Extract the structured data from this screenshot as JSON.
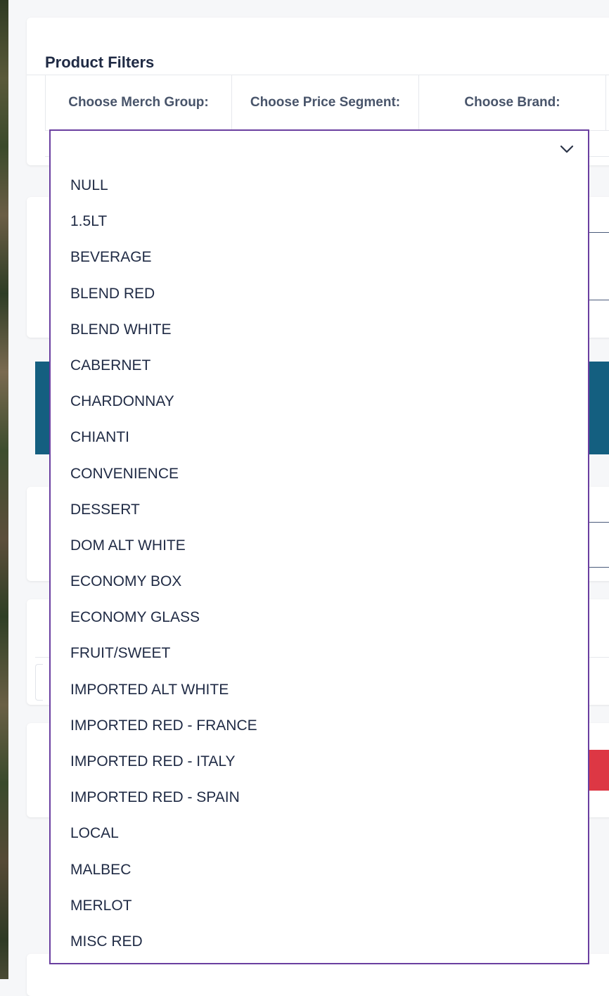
{
  "filters": {
    "title": "Product Filters",
    "merch_group_label": "Choose Merch Group:",
    "price_segment_label": "Choose Price Segment:",
    "brand_label": "Choose Brand:"
  },
  "dropdown": {
    "open_for": "merch_group",
    "icon": "chevron-down-icon",
    "border_color": "#6a3fa0",
    "options": [
      "NULL",
      "1.5LT",
      "BEVERAGE",
      "BLEND RED",
      "BLEND WHITE",
      "CABERNET",
      "CHARDONNAY",
      "CHIANTI",
      "CONVENIENCE",
      "DESSERT",
      "DOM ALT WHITE",
      "ECONOMY BOX",
      "ECONOMY GLASS",
      "FRUIT/SWEET",
      "IMPORTED ALT WHITE",
      "IMPORTED RED - FRANCE",
      "IMPORTED RED - ITALY",
      "IMPORTED RED - SPAIN",
      "LOCAL",
      "MALBEC",
      "MERLOT",
      "MISC RED"
    ]
  },
  "colors": {
    "accent_teal": "#145f80",
    "accent_red": "#dd3744",
    "text_dark": "#1f2a44",
    "label_gray": "#48546a"
  }
}
